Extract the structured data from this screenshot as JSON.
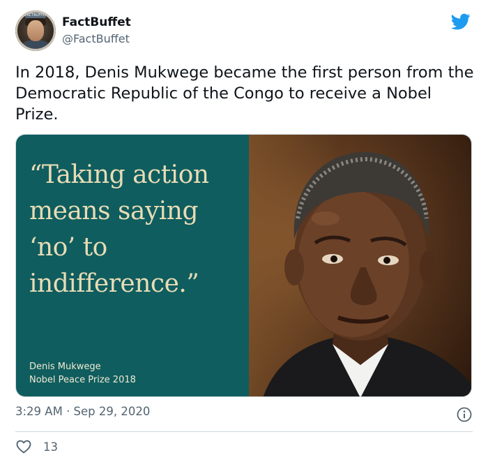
{
  "author": {
    "name": "FactBuffet",
    "handle": "@FactBuffet",
    "avatar_label": "FACTBUFFET"
  },
  "tweet": {
    "text": "In 2018, Denis Mukwege became the first person from the Democratic Republic of the Congo to receive a Nobel Prize."
  },
  "media": {
    "quote": "“Taking action means saying ‘no’ to indifference.”",
    "attribution_name": "Denis Mukwege",
    "attribution_prize": "Nobel Peace Prize 2018",
    "panel_color": "#0f5d5f",
    "quote_color": "#e8dcb5"
  },
  "meta": {
    "timestamp": "3:29 AM · Sep 29, 2020"
  },
  "actions": {
    "likes": "13"
  },
  "icons": {
    "brand": "twitter-bird-icon",
    "info": "info-icon",
    "like": "heart-icon"
  },
  "colors": {
    "brand": "#1d9bf0",
    "secondary_text": "#536471"
  }
}
